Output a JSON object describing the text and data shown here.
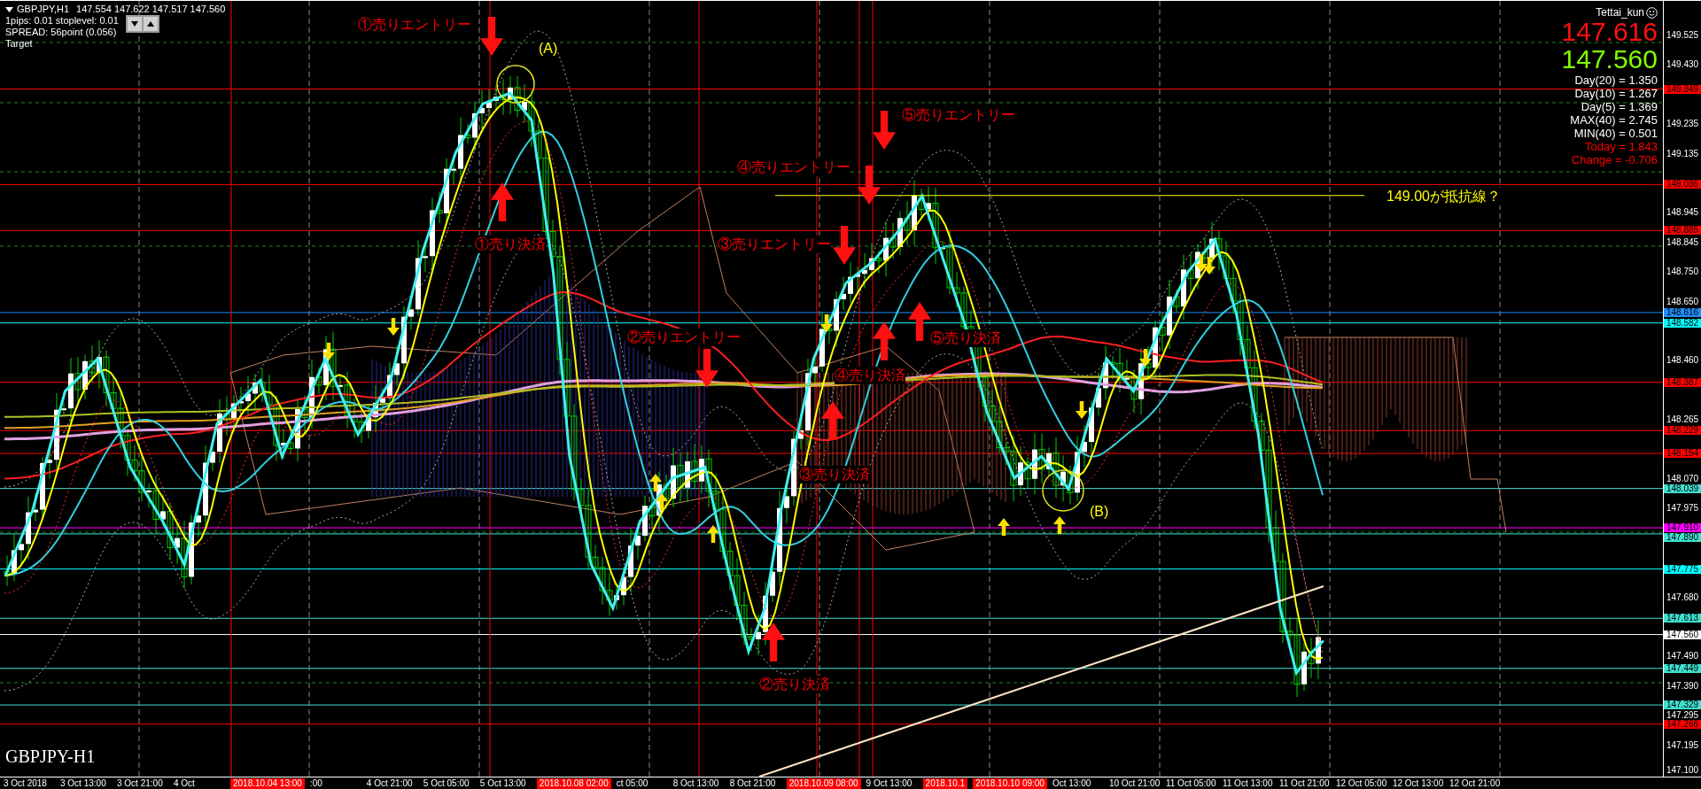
{
  "chart": {
    "title": "GBPJPY,H1",
    "quote": "147.554 147.622 147.517 147.560",
    "info_lines": [
      "1pips: 0.01 stoplevel: 0.01",
      "SPREAD: 56point (0.056)",
      "Target"
    ],
    "symbol_label": "GBPJPY-H1"
  },
  "info_panel": {
    "user": "Tettai_kun",
    "bid": "147.616",
    "ask": "147.560",
    "stats": [
      {
        "text": "Day(20) = 1.350",
        "color": "#ffffff"
      },
      {
        "text": "Day(10) = 1.267",
        "color": "#ffffff"
      },
      {
        "text": "Day(5) = 1.369",
        "color": "#ffffff"
      },
      {
        "text": "MAX(40) = 2.745",
        "color": "#ffffff"
      },
      {
        "text": "MIN(40) = 0.501",
        "color": "#ffffff"
      },
      {
        "text": "Today = 1.843",
        "color": "#ff0000"
      },
      {
        "text": "Change = -0.706",
        "color": "#ff0000"
      }
    ]
  },
  "annotations": [
    {
      "text": "①売りエントリー",
      "color": "#ff0000"
    },
    {
      "text": "(A)",
      "color": "#ffff00"
    },
    {
      "text": "①売り決済",
      "color": "#ff0000"
    },
    {
      "text": "⑤売りエントリー",
      "color": "#ff0000"
    },
    {
      "text": "④売りエントリー",
      "color": "#ff0000"
    },
    {
      "text": "③売りエントリー",
      "color": "#ff0000"
    },
    {
      "text": "149.00が抵抗線？",
      "color": "#ffff00"
    },
    {
      "text": "②売りエントリー",
      "color": "#ff0000"
    },
    {
      "text": "⑤売り決済",
      "color": "#ff0000"
    },
    {
      "text": "④売り決済",
      "color": "#ff0000"
    },
    {
      "text": "③売り決済",
      "color": "#ff0000"
    },
    {
      "text": "②売り決済",
      "color": "#ff0000"
    },
    {
      "text": "(B)",
      "color": "#ffff00"
    }
  ],
  "price_axis": {
    "ticks": [
      "149.525",
      "149.430",
      "149.235",
      "149.135",
      "148.945",
      "148.845",
      "148.750",
      "148.650",
      "148.460",
      "148.265",
      "148.070",
      "147.975",
      "147.680",
      "147.490",
      "147.390",
      "147.295",
      "147.195",
      "147.100"
    ],
    "tags": [
      {
        "label": "149.349",
        "color": "#ff0000"
      },
      {
        "label": "149.036",
        "color": "#ff0000"
      },
      {
        "label": "148.885",
        "color": "#ff0000"
      },
      {
        "label": "148.616",
        "color": "#1e90ff"
      },
      {
        "label": "148.582",
        "color": "#00ffff"
      },
      {
        "label": "148.387",
        "color": "#ff0000"
      },
      {
        "label": "148.229",
        "color": "#ff0000"
      },
      {
        "label": "148.154",
        "color": "#ff0000"
      },
      {
        "label": "148.039",
        "color": "#40e0d0"
      },
      {
        "label": "147.910",
        "color": "#ff00ff"
      },
      {
        "label": "147.890",
        "color": "#40e0d0"
      },
      {
        "label": "147.775",
        "color": "#00ffff"
      },
      {
        "label": "147.613",
        "color": "#40e0d0"
      },
      {
        "label": "147.560",
        "color": "#ffffff"
      },
      {
        "label": "147.449",
        "color": "#40e0d0"
      },
      {
        "label": "147.329",
        "color": "#40e0d0"
      },
      {
        "label": "147.266",
        "color": "#ff0000"
      }
    ]
  },
  "time_axis": [
    {
      "label": "3 Oct 2018",
      "kind": "tick"
    },
    {
      "label": "3 Oct 13:00",
      "kind": "tick"
    },
    {
      "label": "3 Oct 21:00",
      "kind": "tick"
    },
    {
      "label": "4 Oct",
      "kind": "tick"
    },
    {
      "label": "2018.10.04 13:00",
      "kind": "marker"
    },
    {
      "label": ":00",
      "kind": "tick"
    },
    {
      "label": "4 Oct 21:00",
      "kind": "tick"
    },
    {
      "label": "5 Oct 05:00",
      "kind": "tick"
    },
    {
      "label": "5 Oct 13:00",
      "kind": "tick"
    },
    {
      "label": "2018.10.08 02:00",
      "kind": "marker"
    },
    {
      "label": "ct 05:00",
      "kind": "tick"
    },
    {
      "label": "8 Oct 13:00",
      "kind": "tick"
    },
    {
      "label": "8 Oct 21:00",
      "kind": "tick"
    },
    {
      "label": "2018.10.09 08:00",
      "kind": "marker"
    },
    {
      "label": "9 Oct 13:00",
      "kind": "tick"
    },
    {
      "label": "2018.10.1",
      "kind": "marker"
    },
    {
      "label": "2018.10.10 09:00",
      "kind": "marker"
    },
    {
      "label": "Oct 13:00",
      "kind": "tick"
    },
    {
      "label": "10 Oct 21:00",
      "kind": "tick"
    },
    {
      "label": "11 Oct 05:00",
      "kind": "tick"
    },
    {
      "label": "11 Oct 13:00",
      "kind": "tick"
    },
    {
      "label": "11 Oct 21:00",
      "kind": "tick"
    },
    {
      "label": "12 Oct 05:00",
      "kind": "tick"
    },
    {
      "label": "12 Oct 13:00",
      "kind": "tick"
    },
    {
      "label": "12 Oct 21:00",
      "kind": "tick"
    }
  ]
}
